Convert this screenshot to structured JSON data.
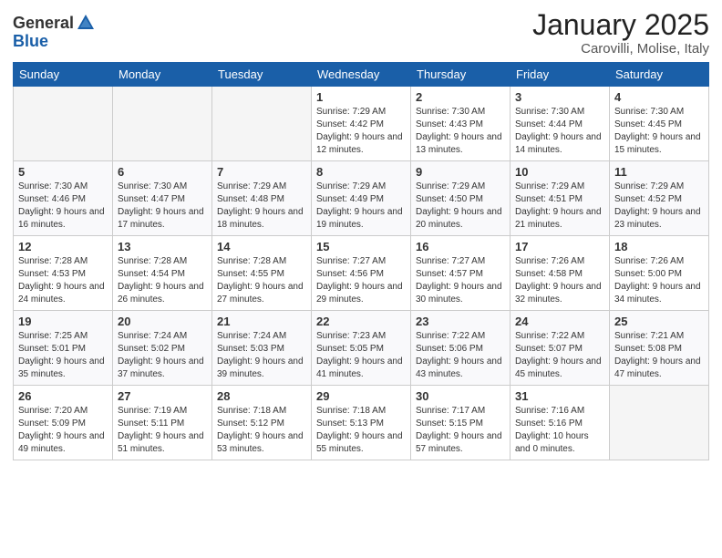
{
  "header": {
    "logo_general": "General",
    "logo_blue": "Blue",
    "month": "January 2025",
    "location": "Carovilli, Molise, Italy"
  },
  "weekdays": [
    "Sunday",
    "Monday",
    "Tuesday",
    "Wednesday",
    "Thursday",
    "Friday",
    "Saturday"
  ],
  "weeks": [
    [
      {
        "day": "",
        "sunrise": "",
        "sunset": "",
        "daylight": "",
        "empty": true
      },
      {
        "day": "",
        "sunrise": "",
        "sunset": "",
        "daylight": "",
        "empty": true
      },
      {
        "day": "",
        "sunrise": "",
        "sunset": "",
        "daylight": "",
        "empty": true
      },
      {
        "day": "1",
        "sunrise": "Sunrise: 7:29 AM",
        "sunset": "Sunset: 4:42 PM",
        "daylight": "Daylight: 9 hours and 12 minutes."
      },
      {
        "day": "2",
        "sunrise": "Sunrise: 7:30 AM",
        "sunset": "Sunset: 4:43 PM",
        "daylight": "Daylight: 9 hours and 13 minutes."
      },
      {
        "day": "3",
        "sunrise": "Sunrise: 7:30 AM",
        "sunset": "Sunset: 4:44 PM",
        "daylight": "Daylight: 9 hours and 14 minutes."
      },
      {
        "day": "4",
        "sunrise": "Sunrise: 7:30 AM",
        "sunset": "Sunset: 4:45 PM",
        "daylight": "Daylight: 9 hours and 15 minutes."
      }
    ],
    [
      {
        "day": "5",
        "sunrise": "Sunrise: 7:30 AM",
        "sunset": "Sunset: 4:46 PM",
        "daylight": "Daylight: 9 hours and 16 minutes."
      },
      {
        "day": "6",
        "sunrise": "Sunrise: 7:30 AM",
        "sunset": "Sunset: 4:47 PM",
        "daylight": "Daylight: 9 hours and 17 minutes."
      },
      {
        "day": "7",
        "sunrise": "Sunrise: 7:29 AM",
        "sunset": "Sunset: 4:48 PM",
        "daylight": "Daylight: 9 hours and 18 minutes."
      },
      {
        "day": "8",
        "sunrise": "Sunrise: 7:29 AM",
        "sunset": "Sunset: 4:49 PM",
        "daylight": "Daylight: 9 hours and 19 minutes."
      },
      {
        "day": "9",
        "sunrise": "Sunrise: 7:29 AM",
        "sunset": "Sunset: 4:50 PM",
        "daylight": "Daylight: 9 hours and 20 minutes."
      },
      {
        "day": "10",
        "sunrise": "Sunrise: 7:29 AM",
        "sunset": "Sunset: 4:51 PM",
        "daylight": "Daylight: 9 hours and 21 minutes."
      },
      {
        "day": "11",
        "sunrise": "Sunrise: 7:29 AM",
        "sunset": "Sunset: 4:52 PM",
        "daylight": "Daylight: 9 hours and 23 minutes."
      }
    ],
    [
      {
        "day": "12",
        "sunrise": "Sunrise: 7:28 AM",
        "sunset": "Sunset: 4:53 PM",
        "daylight": "Daylight: 9 hours and 24 minutes."
      },
      {
        "day": "13",
        "sunrise": "Sunrise: 7:28 AM",
        "sunset": "Sunset: 4:54 PM",
        "daylight": "Daylight: 9 hours and 26 minutes."
      },
      {
        "day": "14",
        "sunrise": "Sunrise: 7:28 AM",
        "sunset": "Sunset: 4:55 PM",
        "daylight": "Daylight: 9 hours and 27 minutes."
      },
      {
        "day": "15",
        "sunrise": "Sunrise: 7:27 AM",
        "sunset": "Sunset: 4:56 PM",
        "daylight": "Daylight: 9 hours and 29 minutes."
      },
      {
        "day": "16",
        "sunrise": "Sunrise: 7:27 AM",
        "sunset": "Sunset: 4:57 PM",
        "daylight": "Daylight: 9 hours and 30 minutes."
      },
      {
        "day": "17",
        "sunrise": "Sunrise: 7:26 AM",
        "sunset": "Sunset: 4:58 PM",
        "daylight": "Daylight: 9 hours and 32 minutes."
      },
      {
        "day": "18",
        "sunrise": "Sunrise: 7:26 AM",
        "sunset": "Sunset: 5:00 PM",
        "daylight": "Daylight: 9 hours and 34 minutes."
      }
    ],
    [
      {
        "day": "19",
        "sunrise": "Sunrise: 7:25 AM",
        "sunset": "Sunset: 5:01 PM",
        "daylight": "Daylight: 9 hours and 35 minutes."
      },
      {
        "day": "20",
        "sunrise": "Sunrise: 7:24 AM",
        "sunset": "Sunset: 5:02 PM",
        "daylight": "Daylight: 9 hours and 37 minutes."
      },
      {
        "day": "21",
        "sunrise": "Sunrise: 7:24 AM",
        "sunset": "Sunset: 5:03 PM",
        "daylight": "Daylight: 9 hours and 39 minutes."
      },
      {
        "day": "22",
        "sunrise": "Sunrise: 7:23 AM",
        "sunset": "Sunset: 5:05 PM",
        "daylight": "Daylight: 9 hours and 41 minutes."
      },
      {
        "day": "23",
        "sunrise": "Sunrise: 7:22 AM",
        "sunset": "Sunset: 5:06 PM",
        "daylight": "Daylight: 9 hours and 43 minutes."
      },
      {
        "day": "24",
        "sunrise": "Sunrise: 7:22 AM",
        "sunset": "Sunset: 5:07 PM",
        "daylight": "Daylight: 9 hours and 45 minutes."
      },
      {
        "day": "25",
        "sunrise": "Sunrise: 7:21 AM",
        "sunset": "Sunset: 5:08 PM",
        "daylight": "Daylight: 9 hours and 47 minutes."
      }
    ],
    [
      {
        "day": "26",
        "sunrise": "Sunrise: 7:20 AM",
        "sunset": "Sunset: 5:09 PM",
        "daylight": "Daylight: 9 hours and 49 minutes."
      },
      {
        "day": "27",
        "sunrise": "Sunrise: 7:19 AM",
        "sunset": "Sunset: 5:11 PM",
        "daylight": "Daylight: 9 hours and 51 minutes."
      },
      {
        "day": "28",
        "sunrise": "Sunrise: 7:18 AM",
        "sunset": "Sunset: 5:12 PM",
        "daylight": "Daylight: 9 hours and 53 minutes."
      },
      {
        "day": "29",
        "sunrise": "Sunrise: 7:18 AM",
        "sunset": "Sunset: 5:13 PM",
        "daylight": "Daylight: 9 hours and 55 minutes."
      },
      {
        "day": "30",
        "sunrise": "Sunrise: 7:17 AM",
        "sunset": "Sunset: 5:15 PM",
        "daylight": "Daylight: 9 hours and 57 minutes."
      },
      {
        "day": "31",
        "sunrise": "Sunrise: 7:16 AM",
        "sunset": "Sunset: 5:16 PM",
        "daylight": "Daylight: 10 hours and 0 minutes."
      },
      {
        "day": "",
        "sunrise": "",
        "sunset": "",
        "daylight": "",
        "empty": true
      }
    ]
  ]
}
